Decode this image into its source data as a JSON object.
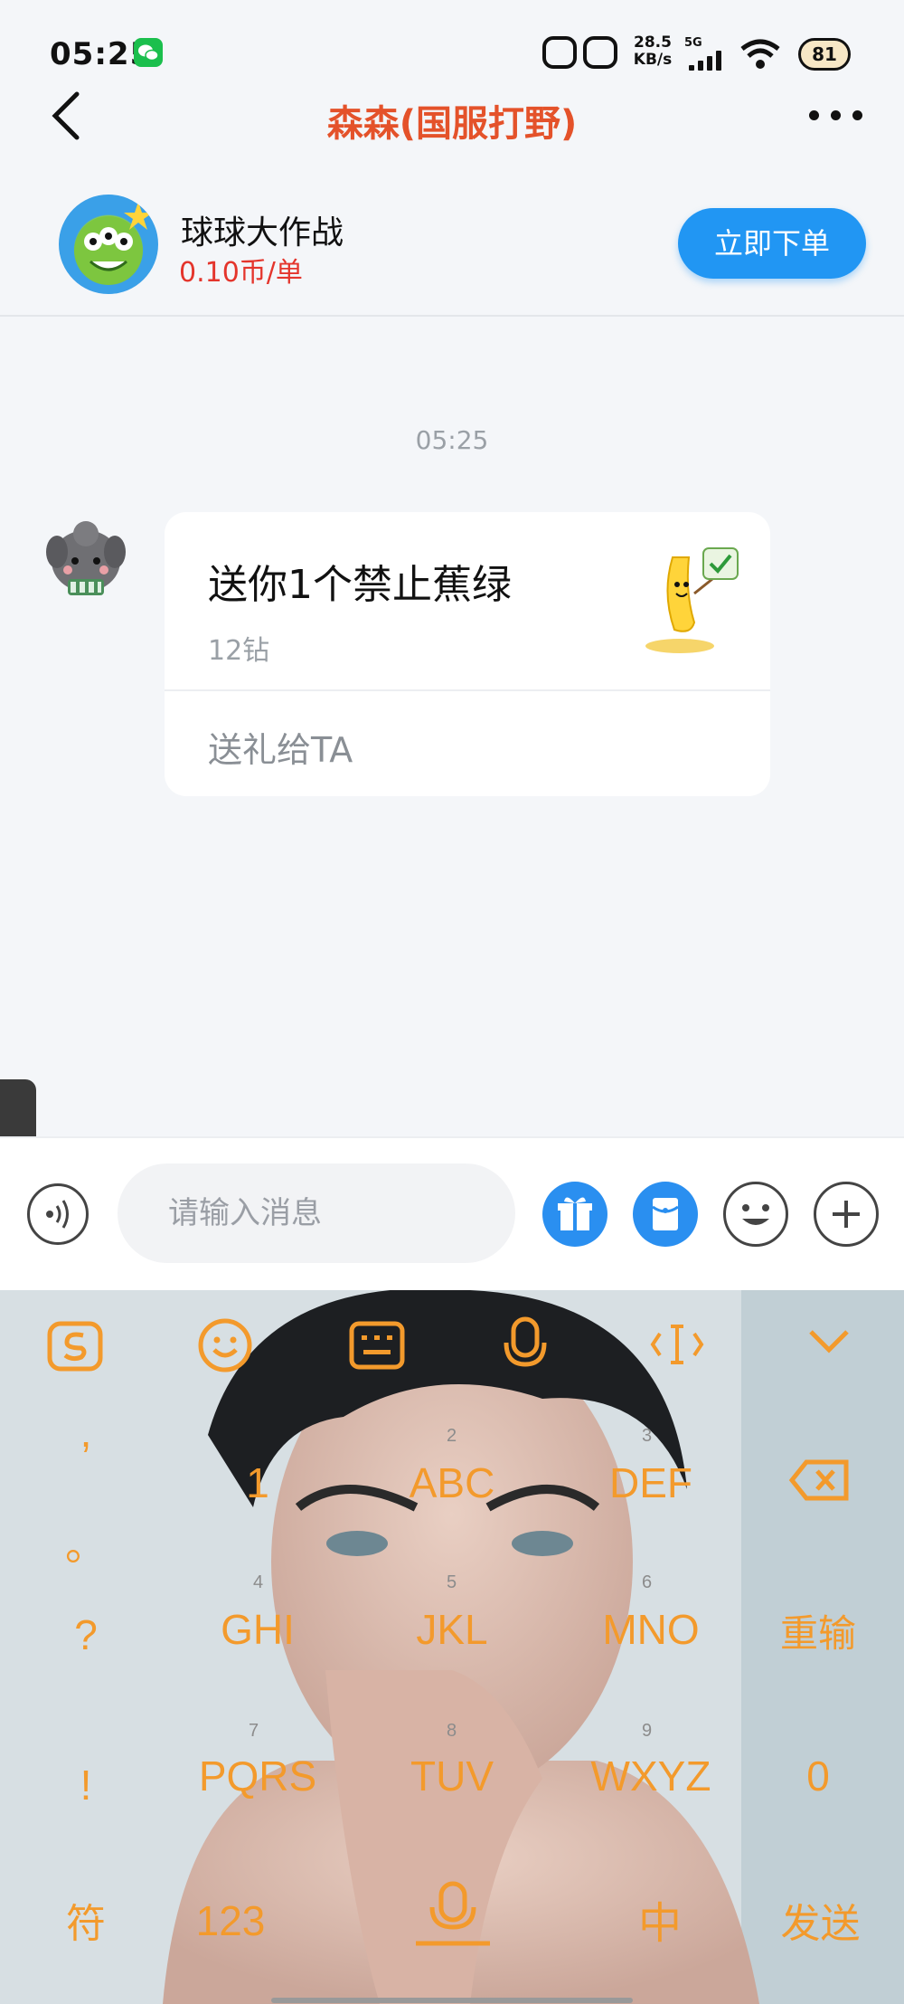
{
  "status_bar": {
    "time": "05:25",
    "net_speed_value": "28.5",
    "net_speed_unit": "KB/s",
    "network": "5G",
    "battery": "81"
  },
  "header": {
    "title": "森森(国服打野)"
  },
  "service": {
    "name": "球球大作战",
    "price": "0.10币/单",
    "order_button": "立即下单"
  },
  "chat": {
    "timestamp": "05:25",
    "gift_card": {
      "title": "送你1个禁止蕉绿",
      "price": "12钻",
      "action": "送礼给TA"
    }
  },
  "input_bar": {
    "placeholder": "请输入消息"
  },
  "keyboard": {
    "punctuation": [
      ",",
      "。",
      "?",
      "!"
    ],
    "row1": [
      {
        "label": "1",
        "digit": ""
      },
      {
        "label": "ABC",
        "digit": "2"
      },
      {
        "label": "DEF",
        "digit": "3"
      }
    ],
    "row2": [
      {
        "label": "GHI",
        "digit": "4"
      },
      {
        "label": "JKL",
        "digit": "5"
      },
      {
        "label": "MNO",
        "digit": "6"
      }
    ],
    "row3": [
      {
        "label": "PQRS",
        "digit": "7"
      },
      {
        "label": "TUV",
        "digit": "8"
      },
      {
        "label": "WXYZ",
        "digit": "9"
      }
    ],
    "reset_key": "重输",
    "zero_key": "0",
    "symbol_key": "符",
    "number_key": "123",
    "lang_key": "中",
    "send_key": "发送"
  },
  "colors": {
    "accent": "#2196f3",
    "title": "#e4522a",
    "price": "#e4352c",
    "keyboard_text": "#f39a2c"
  }
}
